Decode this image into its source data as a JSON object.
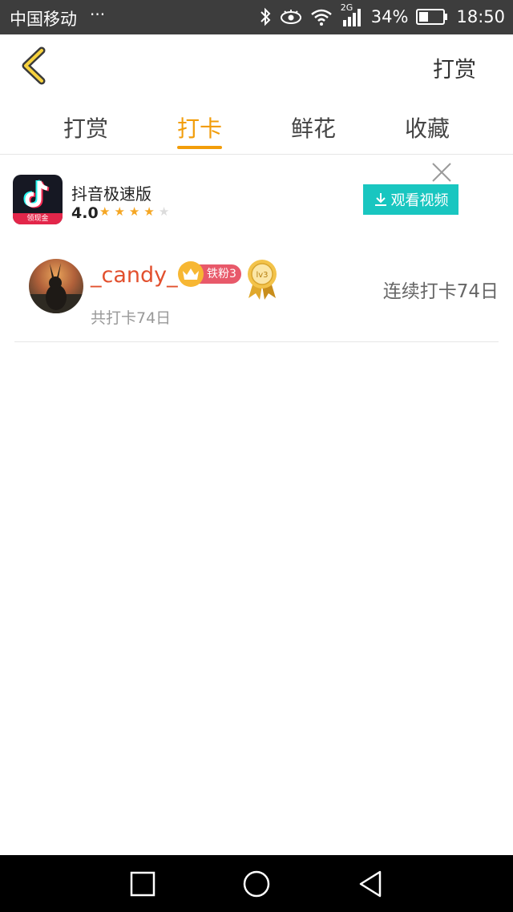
{
  "status_bar": {
    "carrier": "中国移动",
    "dots": "···",
    "network": "2G",
    "battery": "34%",
    "time": "18:50"
  },
  "header": {
    "back_icon": "chevron-left-icon",
    "action_label": "打赏"
  },
  "tabs": [
    {
      "label": "打赏",
      "active": false
    },
    {
      "label": "打卡",
      "active": true
    },
    {
      "label": "鲜花",
      "active": false
    },
    {
      "label": "收藏",
      "active": false
    }
  ],
  "ad": {
    "app_name": "抖音极速版",
    "rating": "4.0",
    "stars_filled": 4,
    "stars_total": 5,
    "logo_strip": "领现金",
    "button_label": "观看视频"
  },
  "checkin_list": [
    {
      "username": "_candy_",
      "fan_badge": "铁粉3",
      "level_medal": "lv3",
      "total": "共打卡74日",
      "streak": "连续打卡74日"
    }
  ],
  "colors": {
    "accent": "#f29d0a",
    "username": "#e2502e",
    "ad_button": "#19c6c0"
  }
}
